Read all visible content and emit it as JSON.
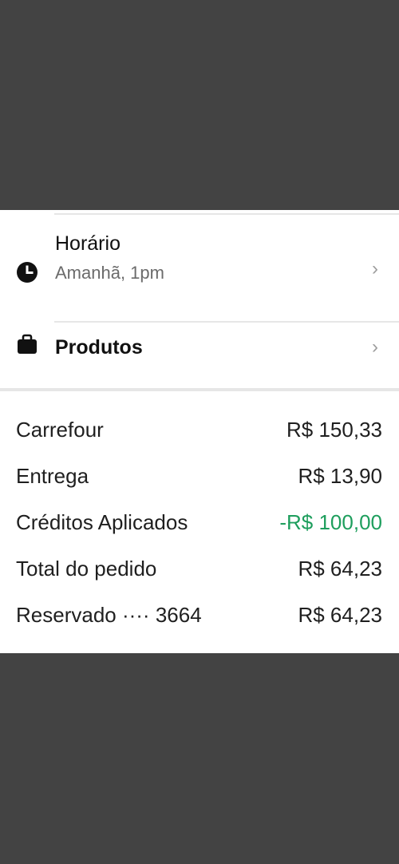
{
  "schedule": {
    "title": "Horário",
    "subtitle": "Amanhã, 1pm",
    "icon": "clock-icon"
  },
  "products": {
    "title": "Produtos",
    "icon": "shopping-bag-icon"
  },
  "summary": {
    "rows": [
      {
        "label": "Carrefour",
        "value": "R$ 150,33"
      },
      {
        "label": "Entrega",
        "value": "R$ 13,90"
      },
      {
        "label": "Créditos Aplicados",
        "value": "-R$ 100,00"
      },
      {
        "label": "Total do pedido",
        "value": "R$ 64,23"
      },
      {
        "label": "Reservado ···· 3664",
        "value": "R$ 64,23"
      }
    ]
  },
  "colors": {
    "background": "#434343",
    "credit": "#1e9e5d"
  }
}
